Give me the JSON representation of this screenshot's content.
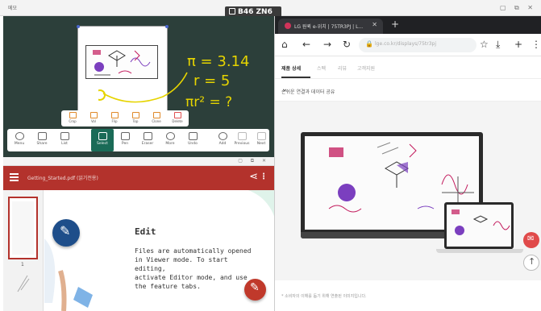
{
  "left_window": {
    "title": "메모"
  },
  "split_badge": "B46 ZN6",
  "whiteboard": {
    "math_lines": [
      "π = 3.14",
      "r = 5",
      "πr² = ?"
    ],
    "submenu": [
      {
        "label": "Crop"
      },
      {
        "label": "Vol"
      },
      {
        "label": "Flip"
      },
      {
        "label": "Top"
      },
      {
        "label": "Clone"
      },
      {
        "label": "Delete"
      }
    ],
    "toolbar": [
      {
        "label": "Menu"
      },
      {
        "label": "Share"
      },
      {
        "label": "List"
      },
      {
        "label": "Select"
      },
      {
        "label": "Pen"
      },
      {
        "label": "Eraser"
      },
      {
        "label": "More"
      },
      {
        "label": "Undo"
      },
      {
        "label": "Add"
      },
      {
        "label": "Previous"
      },
      {
        "label": "Next"
      }
    ]
  },
  "pdf": {
    "file_title": "Getting_Started.pdf (읽기전용)",
    "page_number": "1",
    "heading": "Edit",
    "body_lines": [
      "Files are automatically opened",
      "in Viewer mode. To start editing,",
      "activate Editor mode, and use",
      "the feature tabs."
    ]
  },
  "browser": {
    "tab_title": "LG 원퀵 e-위치 | 75TR3PJ | L...",
    "new_tab": "+",
    "url": "lge.co.kr/displays/75tr3pj",
    "subnav": [
      {
        "label": "제품 상세"
      },
      {
        "label": "스펙"
      },
      {
        "label": "리뷰"
      },
      {
        "label": "고객지원"
      }
    ],
    "section_title": "손쉬운 연결과 데이터 공유",
    "footnote": "* 소비자의 이해를 돕기 위해 연출된 이미지입니다."
  },
  "colors": {
    "board_bg": "#2c3f3a",
    "accent_green": "#1a6b57",
    "pdf_red": "#b3322c",
    "math_yellow": "#e6d400"
  }
}
